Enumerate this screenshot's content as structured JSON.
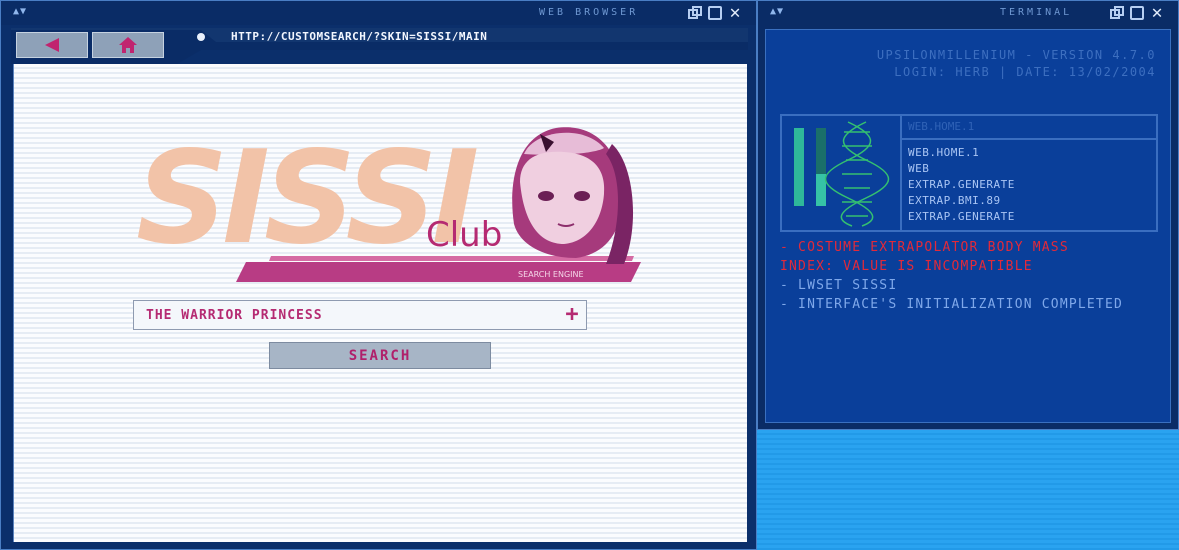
{
  "browser": {
    "title": "WEB BROWSER",
    "url": "HTTP://CUSTOMSEARCH/?SKIN=SISSI/MAIN",
    "logo": {
      "wordmark": "SISSI",
      "club": "Club",
      "tagline": "SEARCH ENGINE"
    },
    "search": {
      "value": "THE WARRIOR PRINCESS",
      "button_label": "SEARCH"
    }
  },
  "terminal": {
    "title": "TERMINAL",
    "version_line": "UPSILONMILLENIUM - VERSION 4.7.0",
    "login_line": "LOGIN: HERB | DATE: 13/02/2004",
    "panel": {
      "header": "WEB.HOME.1",
      "items": [
        "WEB.HOME.1",
        "WEB",
        "EXTRAP.GENERATE",
        "EXTRAP.BMI.89",
        "EXTRAP.GENERATE"
      ]
    },
    "log": [
      "- COSTUME EXTRAPOLATOR BODY MASS",
      "INDEX: VALUE IS INCOMPATIBLE",
      "- LWSET SISSI",
      "- INTERFACE'S INITIALIZATION COMPLETED"
    ]
  },
  "colors": {
    "frame_dark": "#0a2c66",
    "accent_pink": "#b52a72",
    "logo_peach": "#f2c3a8",
    "log_error": "#e22a3a",
    "log_info": "#7fa8ea"
  },
  "icons": {
    "back": "back-arrow-icon",
    "home": "home-icon",
    "restore": "restore-icon",
    "maximize": "maximize-icon",
    "close": "close-icon",
    "plus": "plus-icon",
    "dna": "dna-helix-icon"
  }
}
